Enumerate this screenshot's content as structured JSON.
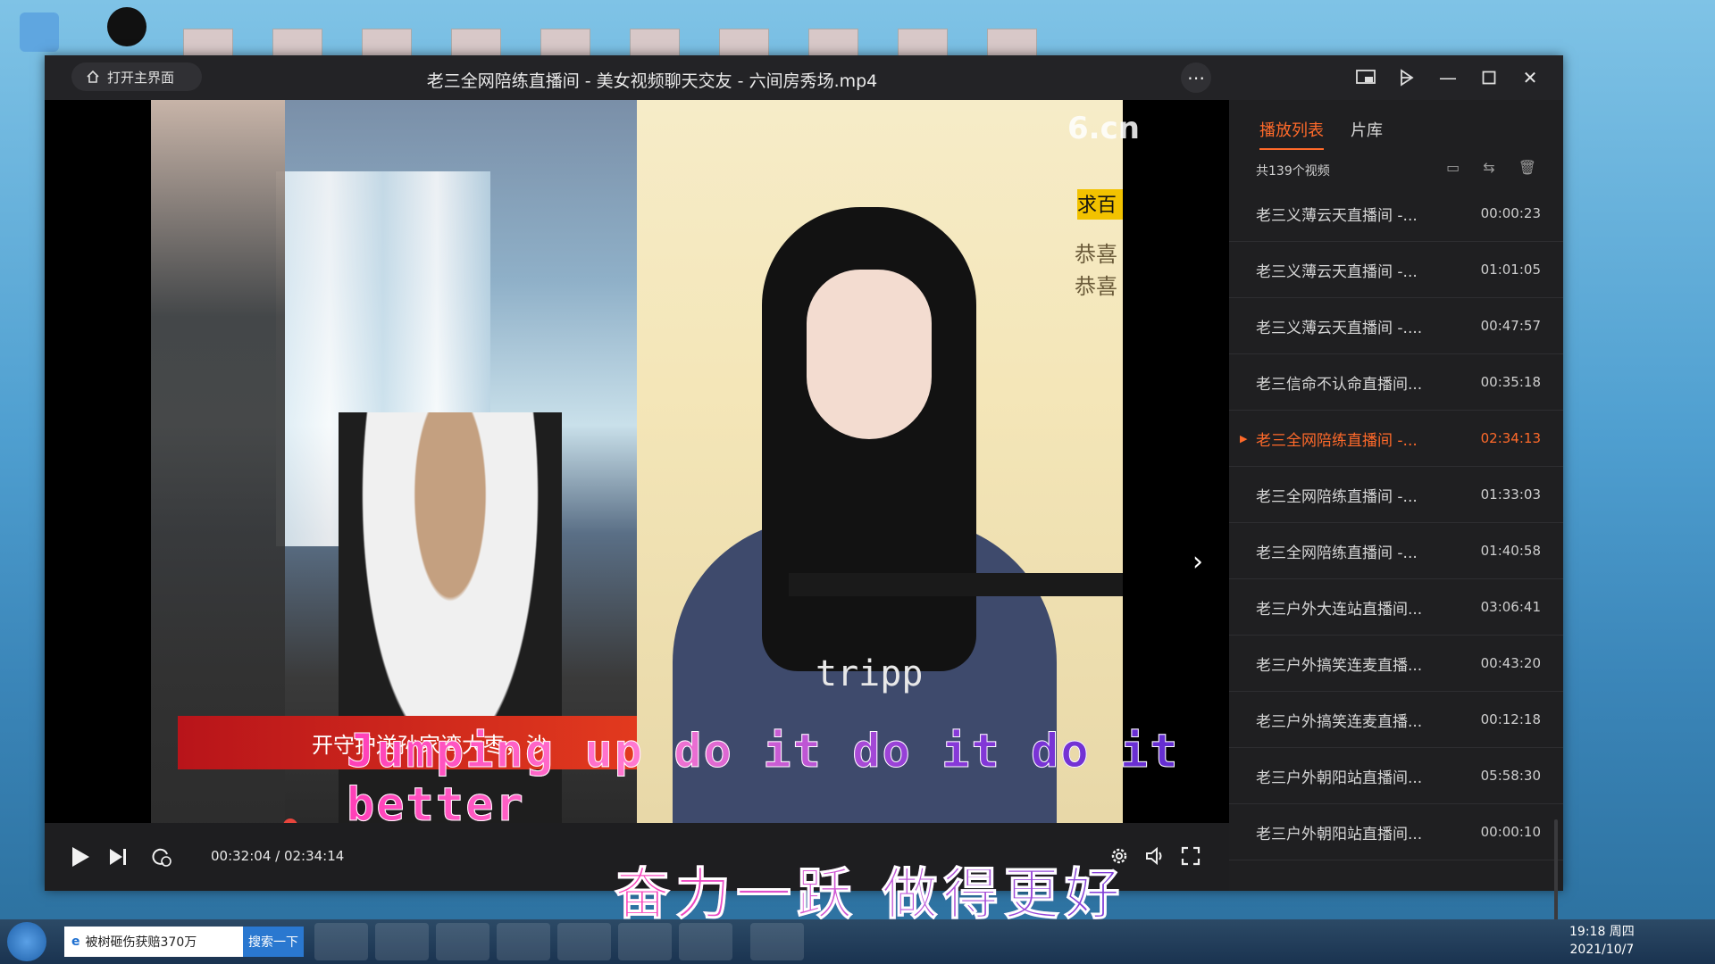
{
  "window": {
    "home_label": "打开主界面",
    "title": "老三全网陪练直播间 - 美女视频聊天交友 - 六间房秀场.mp4"
  },
  "video": {
    "banner_text": "开守护送孙家湾大枣，沙",
    "watermark": "6.cn",
    "side_tag": "求百",
    "side_text_1": "恭喜",
    "side_text_2": "恭喜",
    "shirt_text": "tripp",
    "subtitle_en": "Jumping up do it do it do it better",
    "subtitle_cn": "奋力一跃 做得更好"
  },
  "playback": {
    "time": "00:32:04 / 02:34:14",
    "progress_fraction": 0.2077
  },
  "sidebar": {
    "tab_playlist": "播放列表",
    "tab_library": "片库",
    "count_label": "共139个视频",
    "items": [
      {
        "title": "老三义薄云天直播间 -...",
        "duration": "00:00:23",
        "active": false
      },
      {
        "title": "老三义薄云天直播间 -...",
        "duration": "01:01:05",
        "active": false
      },
      {
        "title": "老三义薄云天直播间 -....",
        "duration": "00:47:57",
        "active": false
      },
      {
        "title": "老三信命不认命直播间...",
        "duration": "00:35:18",
        "active": false
      },
      {
        "title": "老三全网陪练直播间 -...",
        "duration": "02:34:13",
        "active": true
      },
      {
        "title": "老三全网陪练直播间 -...",
        "duration": "01:33:03",
        "active": false
      },
      {
        "title": "老三全网陪练直播间 -...",
        "duration": "01:40:58",
        "active": false
      },
      {
        "title": "老三户外大连站直播间...",
        "duration": "03:06:41",
        "active": false
      },
      {
        "title": "老三户外搞笑连麦直播...",
        "duration": "00:43:20",
        "active": false
      },
      {
        "title": "老三户外搞笑连麦直播...",
        "duration": "00:12:18",
        "active": false
      },
      {
        "title": "老三户外朝阳站直播间...",
        "duration": "05:58:30",
        "active": false
      },
      {
        "title": "老三户外朝阳站直播间...",
        "duration": "00:00:10",
        "active": false
      }
    ]
  },
  "taskbar": {
    "ie_tab_text": "被树砸伤获赔370万",
    "search_label": "搜索一下",
    "clock_time": "19:18 周四",
    "clock_date": "2021/10/7"
  },
  "colors": {
    "accent": "#ff6a2a",
    "progress": "#e8453c"
  }
}
